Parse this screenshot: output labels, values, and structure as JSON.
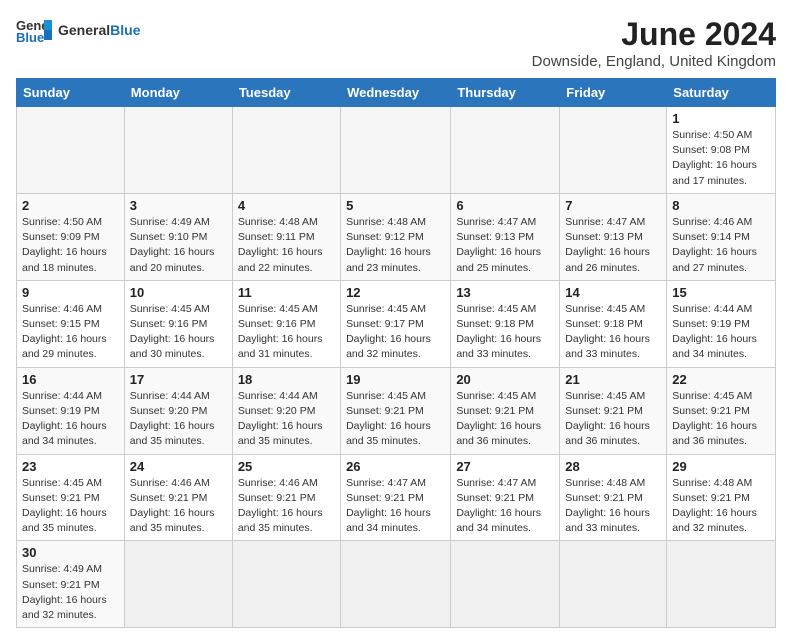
{
  "header": {
    "logo_general": "General",
    "logo_blue": "Blue",
    "month_title": "June 2024",
    "location": "Downside, England, United Kingdom"
  },
  "days_of_week": [
    "Sunday",
    "Monday",
    "Tuesday",
    "Wednesday",
    "Thursday",
    "Friday",
    "Saturday"
  ],
  "weeks": [
    [
      {
        "day": "",
        "info": "",
        "empty": true
      },
      {
        "day": "",
        "info": "",
        "empty": true
      },
      {
        "day": "",
        "info": "",
        "empty": true
      },
      {
        "day": "",
        "info": "",
        "empty": true
      },
      {
        "day": "",
        "info": "",
        "empty": true
      },
      {
        "day": "",
        "info": "",
        "empty": true
      },
      {
        "day": "1",
        "info": "Sunrise: 4:50 AM\nSunset: 9:08 PM\nDaylight: 16 hours and 17 minutes.",
        "empty": false
      }
    ],
    [
      {
        "day": "2",
        "info": "Sunrise: 4:50 AM\nSunset: 9:09 PM\nDaylight: 16 hours and 18 minutes.",
        "empty": false
      },
      {
        "day": "3",
        "info": "Sunrise: 4:49 AM\nSunset: 9:10 PM\nDaylight: 16 hours and 20 minutes.",
        "empty": false
      },
      {
        "day": "4",
        "info": "Sunrise: 4:48 AM\nSunset: 9:11 PM\nDaylight: 16 hours and 22 minutes.",
        "empty": false
      },
      {
        "day": "5",
        "info": "Sunrise: 4:48 AM\nSunset: 9:12 PM\nDaylight: 16 hours and 23 minutes.",
        "empty": false
      },
      {
        "day": "6",
        "info": "Sunrise: 4:47 AM\nSunset: 9:13 PM\nDaylight: 16 hours and 25 minutes.",
        "empty": false
      },
      {
        "day": "7",
        "info": "Sunrise: 4:47 AM\nSunset: 9:13 PM\nDaylight: 16 hours and 26 minutes.",
        "empty": false
      },
      {
        "day": "8",
        "info": "Sunrise: 4:46 AM\nSunset: 9:14 PM\nDaylight: 16 hours and 27 minutes.",
        "empty": false
      }
    ],
    [
      {
        "day": "9",
        "info": "Sunrise: 4:46 AM\nSunset: 9:15 PM\nDaylight: 16 hours and 29 minutes.",
        "empty": false
      },
      {
        "day": "10",
        "info": "Sunrise: 4:45 AM\nSunset: 9:16 PM\nDaylight: 16 hours and 30 minutes.",
        "empty": false
      },
      {
        "day": "11",
        "info": "Sunrise: 4:45 AM\nSunset: 9:16 PM\nDaylight: 16 hours and 31 minutes.",
        "empty": false
      },
      {
        "day": "12",
        "info": "Sunrise: 4:45 AM\nSunset: 9:17 PM\nDaylight: 16 hours and 32 minutes.",
        "empty": false
      },
      {
        "day": "13",
        "info": "Sunrise: 4:45 AM\nSunset: 9:18 PM\nDaylight: 16 hours and 33 minutes.",
        "empty": false
      },
      {
        "day": "14",
        "info": "Sunrise: 4:45 AM\nSunset: 9:18 PM\nDaylight: 16 hours and 33 minutes.",
        "empty": false
      },
      {
        "day": "15",
        "info": "Sunrise: 4:44 AM\nSunset: 9:19 PM\nDaylight: 16 hours and 34 minutes.",
        "empty": false
      }
    ],
    [
      {
        "day": "16",
        "info": "Sunrise: 4:44 AM\nSunset: 9:19 PM\nDaylight: 16 hours and 34 minutes.",
        "empty": false
      },
      {
        "day": "17",
        "info": "Sunrise: 4:44 AM\nSunset: 9:20 PM\nDaylight: 16 hours and 35 minutes.",
        "empty": false
      },
      {
        "day": "18",
        "info": "Sunrise: 4:44 AM\nSunset: 9:20 PM\nDaylight: 16 hours and 35 minutes.",
        "empty": false
      },
      {
        "day": "19",
        "info": "Sunrise: 4:45 AM\nSunset: 9:21 PM\nDaylight: 16 hours and 35 minutes.",
        "empty": false
      },
      {
        "day": "20",
        "info": "Sunrise: 4:45 AM\nSunset: 9:21 PM\nDaylight: 16 hours and 36 minutes.",
        "empty": false
      },
      {
        "day": "21",
        "info": "Sunrise: 4:45 AM\nSunset: 9:21 PM\nDaylight: 16 hours and 36 minutes.",
        "empty": false
      },
      {
        "day": "22",
        "info": "Sunrise: 4:45 AM\nSunset: 9:21 PM\nDaylight: 16 hours and 36 minutes.",
        "empty": false
      }
    ],
    [
      {
        "day": "23",
        "info": "Sunrise: 4:45 AM\nSunset: 9:21 PM\nDaylight: 16 hours and 35 minutes.",
        "empty": false
      },
      {
        "day": "24",
        "info": "Sunrise: 4:46 AM\nSunset: 9:21 PM\nDaylight: 16 hours and 35 minutes.",
        "empty": false
      },
      {
        "day": "25",
        "info": "Sunrise: 4:46 AM\nSunset: 9:21 PM\nDaylight: 16 hours and 35 minutes.",
        "empty": false
      },
      {
        "day": "26",
        "info": "Sunrise: 4:47 AM\nSunset: 9:21 PM\nDaylight: 16 hours and 34 minutes.",
        "empty": false
      },
      {
        "day": "27",
        "info": "Sunrise: 4:47 AM\nSunset: 9:21 PM\nDaylight: 16 hours and 34 minutes.",
        "empty": false
      },
      {
        "day": "28",
        "info": "Sunrise: 4:48 AM\nSunset: 9:21 PM\nDaylight: 16 hours and 33 minutes.",
        "empty": false
      },
      {
        "day": "29",
        "info": "Sunrise: 4:48 AM\nSunset: 9:21 PM\nDaylight: 16 hours and 32 minutes.",
        "empty": false
      }
    ],
    [
      {
        "day": "30",
        "info": "Sunrise: 4:49 AM\nSunset: 9:21 PM\nDaylight: 16 hours and 32 minutes.",
        "empty": false
      },
      {
        "day": "",
        "info": "",
        "empty": true
      },
      {
        "day": "",
        "info": "",
        "empty": true
      },
      {
        "day": "",
        "info": "",
        "empty": true
      },
      {
        "day": "",
        "info": "",
        "empty": true
      },
      {
        "day": "",
        "info": "",
        "empty": true
      },
      {
        "day": "",
        "info": "",
        "empty": true
      }
    ]
  ]
}
